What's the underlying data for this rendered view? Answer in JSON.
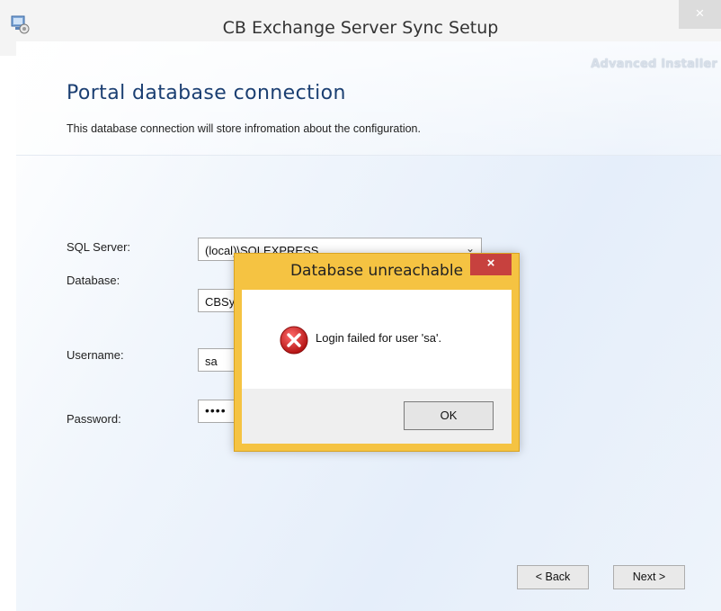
{
  "window": {
    "title": "CB Exchange Server Sync Setup",
    "close_glyph": "×",
    "icon": "setup-app-icon"
  },
  "header": {
    "brand": "Advanced Installer",
    "heading": "Portal database connection",
    "description": "This database connection will store infromation about the configuration."
  },
  "form": {
    "sql_server": {
      "label": "SQL Server:",
      "value": "(local)\\SQLEXPRESS",
      "chevron": "⌄"
    },
    "database": {
      "label": "Database:",
      "value": "CBSy"
    },
    "username": {
      "label": "Username:",
      "value": "sa"
    },
    "password": {
      "label": "Password:",
      "value": "••••"
    }
  },
  "footer": {
    "back_label": "< Back",
    "next_label": "Next >"
  },
  "dialog": {
    "title": "Database unreachable",
    "close_glyph": "×",
    "message": "Login failed for user 'sa'.",
    "ok_label": "OK",
    "icon": "error-icon"
  },
  "colors": {
    "dialog_frame": "#f5c342",
    "dialog_close": "#c7413e",
    "heading": "#1b3f72"
  }
}
